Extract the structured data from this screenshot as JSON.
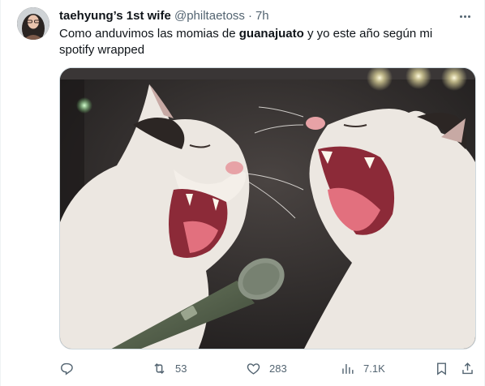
{
  "tweet": {
    "author_name": "taehyung’s 1st wife",
    "handle": "@philtaetoss",
    "separator": "·",
    "time": "7h",
    "text_before": "Como anduvimos las momias de ",
    "text_bold": "guanajuato",
    "text_after": " y yo este año según mi spotify wrapped"
  },
  "actions": {
    "reply_count": "",
    "retweet_count": "53",
    "like_count": "283",
    "views_count": "7.1K"
  },
  "icons": {
    "more": "more-horizontal-icon",
    "reply": "reply-icon",
    "retweet": "retweet-icon",
    "like": "heart-icon",
    "views": "views-chart-icon",
    "bookmark": "bookmark-icon",
    "share": "share-icon"
  },
  "colors": {
    "text_primary": "#0f1419",
    "text_secondary": "#536471",
    "border": "#cfd9de"
  }
}
